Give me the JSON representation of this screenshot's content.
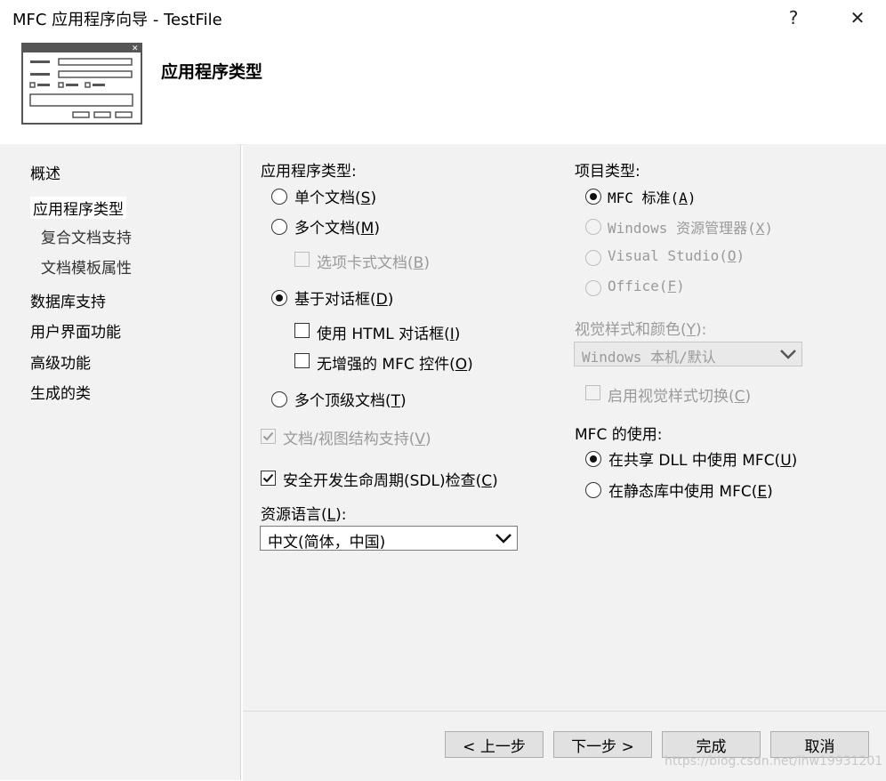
{
  "window": {
    "title": "MFC 应用程序向导 - TestFile",
    "help_label": "?",
    "close_label": "✕"
  },
  "header": {
    "title": "应用程序类型"
  },
  "nav": {
    "items": [
      {
        "label": "概述",
        "selected": false,
        "sub": false
      },
      {
        "label": "应用程序类型",
        "selected": true,
        "sub": false
      },
      {
        "label": "复合文档支持",
        "selected": false,
        "sub": true
      },
      {
        "label": "文档模板属性",
        "selected": false,
        "sub": true
      },
      {
        "label": "数据库支持",
        "selected": false,
        "sub": false
      },
      {
        "label": "用户界面功能",
        "selected": false,
        "sub": false
      },
      {
        "label": "高级功能",
        "selected": false,
        "sub": false
      },
      {
        "label": "生成的类",
        "selected": false,
        "sub": false
      }
    ]
  },
  "app_type": {
    "heading": "应用程序类型:",
    "single_doc": {
      "label": "单个文档(",
      "key": "S",
      "end": ")",
      "checked": false
    },
    "multi_doc": {
      "label": "多个文档(",
      "key": "M",
      "end": ")",
      "checked": false
    },
    "tabbed_docs": {
      "label": "选项卡式文档(",
      "key": "B",
      "end": ")",
      "checked": false,
      "enabled": false
    },
    "dialog_based": {
      "label": "基于对话框(",
      "key": "D",
      "end": ")",
      "checked": true
    },
    "html_dialog": {
      "label": "使用 HTML 对话框(",
      "key": "I",
      "end": ")",
      "checked": false
    },
    "no_mfc_controls": {
      "label": "无增强的 MFC 控件(",
      "key": "O",
      "end": ")",
      "checked": false
    },
    "multi_toplevel": {
      "label": "多个顶级文档(",
      "key": "T",
      "end": ")",
      "checked": false
    },
    "docview": {
      "label": "文档/视图结构支持(",
      "key": "V",
      "end": ")",
      "checked": true,
      "enabled": false
    },
    "sdl": {
      "label": "安全开发生命周期(SDL)检查(",
      "key": "C",
      "end": ")",
      "checked": true
    },
    "resource_lang": {
      "label": "资源语言(",
      "key": "L",
      "end": "):",
      "value": "中文(简体，中国)"
    }
  },
  "project_type": {
    "heading": "项目类型:",
    "mfc_standard": {
      "label": "MFC 标准(",
      "key": "A",
      "end": ")",
      "checked": true
    },
    "explorer": {
      "label": "Windows 资源管理器(",
      "key": "X",
      "end": ")",
      "enabled": false
    },
    "visual_studio": {
      "label": "Visual Studio(",
      "key": "O",
      "end": ")",
      "enabled": false
    },
    "office": {
      "label": "Office(",
      "key": "F",
      "end": ")",
      "enabled": false
    },
    "visual_style": {
      "label": "视觉样式和颜色(",
      "key": "Y",
      "end": "):",
      "value": "Windows 本机/默认"
    },
    "style_switch": {
      "label": "启用视觉样式切换(",
      "key": "C",
      "end": ")",
      "enabled": false
    },
    "mfc_use_heading": "MFC 的使用:",
    "shared_dll": {
      "label": "在共享 DLL 中使用 MFC(",
      "key": "U",
      "end": ")",
      "checked": true
    },
    "static_lib": {
      "label": "在静态库中使用 MFC(",
      "key": "E",
      "end": ")",
      "checked": false
    }
  },
  "buttons": {
    "prev": "< 上一步",
    "next": "下一步 >",
    "finish": "完成",
    "cancel": "取消"
  },
  "watermark": "https://blog.csdn.net/lhw19931201"
}
